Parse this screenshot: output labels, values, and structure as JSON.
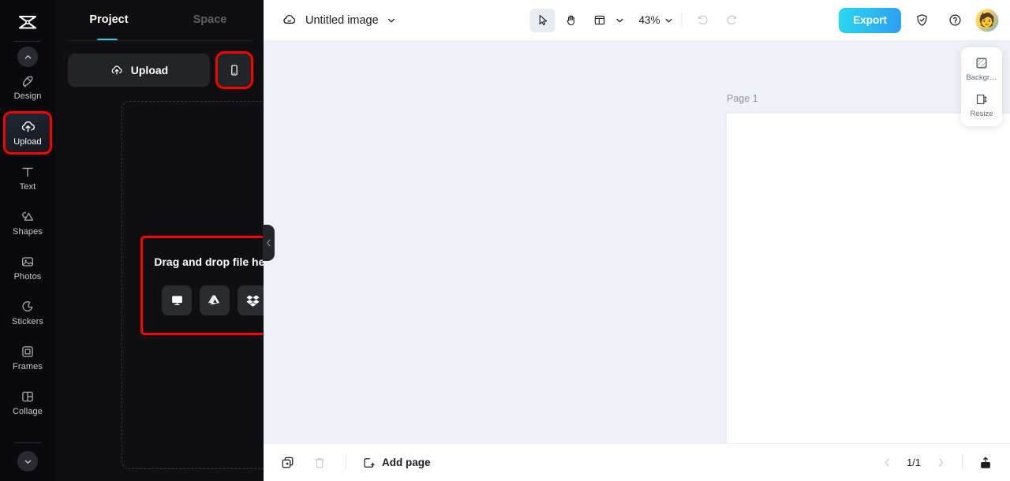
{
  "rail": {
    "logo": "capcut-logo",
    "collapse_up": "chevron-up-icon",
    "collapse_down": "chevron-down-icon",
    "items": [
      {
        "label": "Design",
        "icon": "design-icon",
        "active": false
      },
      {
        "label": "Upload",
        "icon": "upload-cloud-icon",
        "active": true,
        "highlighted": true
      },
      {
        "label": "Text",
        "icon": "text-icon",
        "active": false
      },
      {
        "label": "Shapes",
        "icon": "shapes-icon",
        "active": false
      },
      {
        "label": "Photos",
        "icon": "photos-icon",
        "active": false
      },
      {
        "label": "Stickers",
        "icon": "stickers-icon",
        "active": false
      },
      {
        "label": "Frames",
        "icon": "frames-icon",
        "active": false
      },
      {
        "label": "Collage",
        "icon": "collage-icon",
        "active": false
      }
    ]
  },
  "panel": {
    "tabs": [
      {
        "label": "Project",
        "active": true
      },
      {
        "label": "Space",
        "active": false
      }
    ],
    "upload_label": "Upload",
    "upload_icon": "upload-cloud-icon",
    "mobile_icon": "mobile-phone-icon",
    "dropzone": {
      "title": "Drag and drop file here",
      "sources": [
        {
          "name": "computer",
          "icon": "monitor-icon"
        },
        {
          "name": "google-drive",
          "icon": "google-drive-icon"
        },
        {
          "name": "dropbox",
          "icon": "dropbox-icon"
        }
      ]
    },
    "collapse_icon": "chevron-left-icon"
  },
  "topbar": {
    "cloud_icon": "cloud-icon",
    "document_title": "Untitled image",
    "title_chevron": "chevron-down-icon",
    "tools": [
      {
        "name": "select-tool",
        "icon": "cursor-arrow-icon",
        "active": true
      },
      {
        "name": "hand-tool",
        "icon": "hand-icon",
        "active": false
      },
      {
        "name": "layout-tool",
        "icon": "layout-grid-icon",
        "active": false
      }
    ],
    "layout_chevron": "chevron-down-icon",
    "zoom_value": "43%",
    "zoom_chevron": "chevron-down-icon",
    "undo_icon": "undo-icon",
    "redo_icon": "redo-icon",
    "export_label": "Export",
    "shield_icon": "shield-check-icon",
    "help_icon": "help-circle-icon",
    "avatar": "user-avatar"
  },
  "canvas": {
    "page_label": "Page 1",
    "duplicate_icon": "duplicate-page-icon",
    "more_icon": "more-options-icon"
  },
  "float_tools": [
    {
      "label": "Backgr…",
      "icon": "background-icon",
      "name": "background"
    },
    {
      "label": "Resize",
      "icon": "resize-icon",
      "name": "resize"
    }
  ],
  "bottombar": {
    "duplicate_icon": "duplicate-icon",
    "delete_icon": "trash-icon",
    "add_page_label": "Add page",
    "add_page_icon": "add-page-icon",
    "prev_icon": "chevron-left-icon",
    "page_indicator": "1/1",
    "next_icon": "chevron-right-icon",
    "export_icon": "export-up-icon"
  },
  "colors": {
    "accent": "#1fd2e4",
    "export_gradient_start": "#2ad8ef",
    "export_gradient_end": "#2e9df2",
    "highlight": "#ff0000",
    "panel_bg": "#0f0f11",
    "rail_bg": "#0a0a0c",
    "canvas_bg": "#eef2f6"
  }
}
